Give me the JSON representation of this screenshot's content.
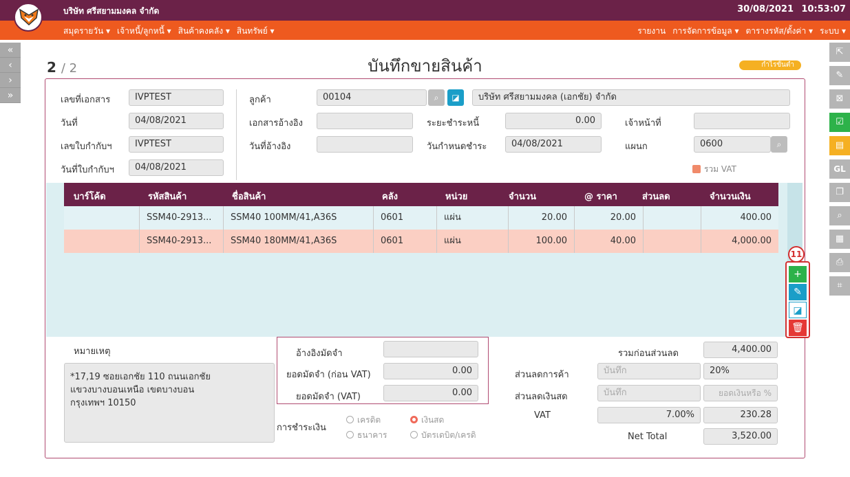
{
  "header": {
    "company": "บริษัท ศรีสยามมงคล จำกัด",
    "date": "30/08/2021",
    "time": "10:53:07"
  },
  "menu": {
    "left": [
      "สมุดรายวัน ▾",
      "เจ้าหนี้/ลูกหนี้ ▾",
      "สินค้าคงคลัง ▾",
      "สินทรัพย์ ▾"
    ],
    "right": [
      "รายงาน",
      "การจัดการข้อมูล ▾",
      "ตารางรหัส/ตั้งค่า ▾",
      "ระบบ ▾"
    ]
  },
  "nav": {
    "left": [
      "«",
      "‹",
      "›",
      "»"
    ],
    "right_icons": [
      "export-icon",
      "edit-doc-icon",
      "cancel-doc-icon",
      "approve-icon",
      "print-doc-icon",
      "gl-icon",
      "copy-icon",
      "search-doc-icon",
      "table-icon",
      "printer-icon",
      "scan-icon"
    ],
    "gl_label": "GL"
  },
  "page": {
    "current": "2",
    "total": "/ 2",
    "title": "บันทึกขายสินค้า",
    "badge": "กำไรขั้นต่ำ"
  },
  "form": {
    "doc_no_label": "เลขที่เอกสาร",
    "doc_no": "IVPTEST",
    "date_label": "วันที่",
    "date": "04/08/2021",
    "tax_inv_label": "เลขใบกำกับฯ",
    "tax_inv": "IVPTEST",
    "tax_inv_date_label": "วันที่ใบกำกับฯ",
    "tax_inv_date": "04/08/2021",
    "customer_label": "ลูกค้า",
    "customer_code": "00104",
    "customer_name": "บริษัท ศรีสยามมงคล (เอกชัย) จำกัด",
    "ref_doc_label": "เอกสารอ้างอิง",
    "ref_doc": "",
    "ref_date_label": "วันที่อ้างอิง",
    "ref_date": "",
    "credit_term_label": "ระยะชำระหนี้",
    "credit_term": "0.00",
    "due_date_label": "วันกำหนดชำระ",
    "due_date": "04/08/2021",
    "officer_label": "เจ้าหน้าที่",
    "officer": "",
    "dept_label": "แผนก",
    "dept": "0600",
    "vat_include_label": "รวม VAT"
  },
  "table": {
    "headers": [
      "บาร์โค้ด",
      "รหัสสินค้า",
      "ชื่อสินค้า",
      "คลัง",
      "หน่วย",
      "จำนวน",
      "@ ราคา",
      "ส่วนลด",
      "จำนวนเงิน"
    ],
    "rows": [
      [
        "",
        "SSM40-2913...",
        "SSM40 100MM/41,A36S",
        "0601",
        "แผ่น",
        "20.00",
        "20.00",
        "",
        "400.00"
      ],
      [
        "",
        "SSM40-2913...",
        "SSM40 180MM/41,A36S",
        "0601",
        "แผ่น",
        "100.00",
        "40.00",
        "",
        "4,000.00"
      ]
    ]
  },
  "actions": {
    "step_number": "11"
  },
  "memo": {
    "label": "หมายเหตุ",
    "lines": [
      "*17,19 ซอยเอกชัย 110 ถนนเอกชัย",
      "แขวงบางบอนเหนือ เขตบางบอน",
      "กรุงเทพฯ 10150"
    ]
  },
  "deposit": {
    "ref_label": "อ้างอิงมัดจำ",
    "ref": "",
    "pre_vat_label": "ยอดมัดจำ (ก่อน VAT)",
    "pre_vat": "0.00",
    "vat_label": "ยอดมัดจำ (VAT)",
    "vat": "0.00"
  },
  "payment": {
    "label": "การชำระเงิน",
    "options": [
      "เครดิต",
      "เงินสด",
      "ธนาคาร",
      "บัตรเดบิต/เครดิ"
    ],
    "selected": "เงินสด"
  },
  "totals": {
    "before_discount_label": "รวมก่อนส่วนลด",
    "before_discount": "4,400.00",
    "trade_discount_label": "ส่วนลดการค้า",
    "trade_discount_ph": "บันทึก",
    "trade_discount": "20%",
    "cash_discount_label": "ส่วนลดเงินสด",
    "cash_discount_ph": "บันทึก",
    "cash_discount_ph2": "ยอดเงินหรือ %",
    "vat_label": "VAT",
    "vat_rate": "7.00%",
    "vat": "230.28",
    "net_label": "Net Total",
    "net": "3,520.00"
  }
}
